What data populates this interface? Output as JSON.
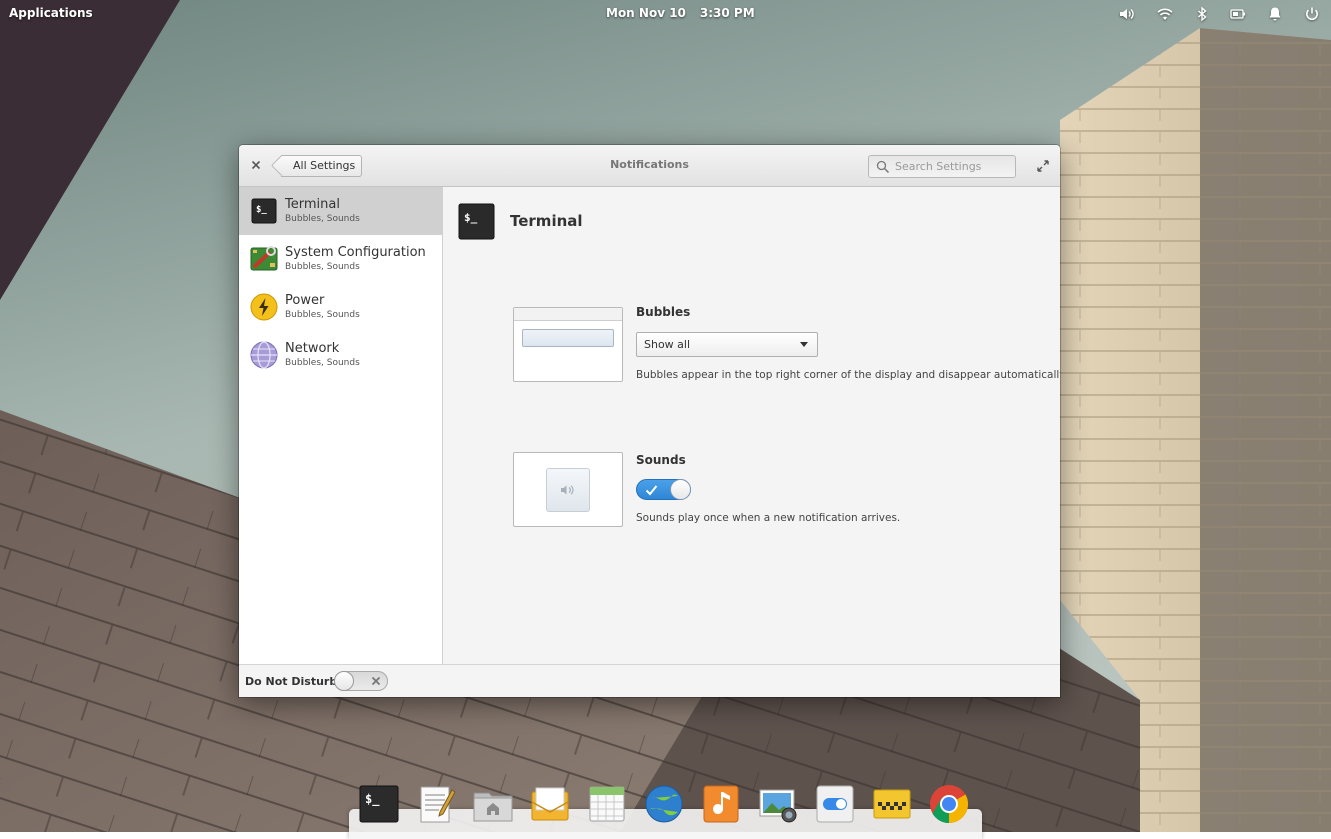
{
  "top_panel": {
    "applications_label": "Applications",
    "date": "Mon Nov 10",
    "time": "3:30 PM",
    "indicators": [
      "volume-icon",
      "wifi-icon",
      "bluetooth-icon",
      "battery-icon",
      "notifications-bell-icon",
      "power-icon"
    ]
  },
  "window": {
    "title": "Notifications",
    "back_label": "All Settings",
    "search_placeholder": "Search Settings",
    "sidebar": {
      "items": [
        {
          "title": "Terminal",
          "subtitle": "Bubbles, Sounds",
          "icon": "terminal-icon",
          "selected": true
        },
        {
          "title": "System Configuration",
          "subtitle": "Bubbles, Sounds",
          "icon": "system-configuration-icon",
          "selected": false
        },
        {
          "title": "Power",
          "subtitle": "Bubbles, Sounds",
          "icon": "power-lightning-icon",
          "selected": false
        },
        {
          "title": "Network",
          "subtitle": "Bubbles, Sounds",
          "icon": "network-globe-icon",
          "selected": false
        }
      ]
    },
    "footer": {
      "dnd_label": "Do Not Disturb",
      "dnd_enabled": false
    },
    "content": {
      "app_title": "Terminal",
      "bubbles": {
        "title": "Bubbles",
        "selected_option": "Show all",
        "description": "Bubbles appear in the top right corner of the display and disappear automatically."
      },
      "sounds": {
        "title": "Sounds",
        "enabled": true,
        "description": "Sounds play once when a new notification arrives."
      }
    }
  },
  "dock": {
    "items": [
      "terminal-icon",
      "text-editor-icon",
      "files-icon",
      "mail-icon",
      "calendar-icon",
      "browser-globe-icon",
      "music-icon",
      "photos-icon",
      "switchboard-settings-icon",
      "taxi-icon",
      "chrome-icon"
    ]
  },
  "colors": {
    "accent": "#3689e6",
    "selected_row": "#d0d0d0",
    "window_bg": "#f4f4f4"
  }
}
